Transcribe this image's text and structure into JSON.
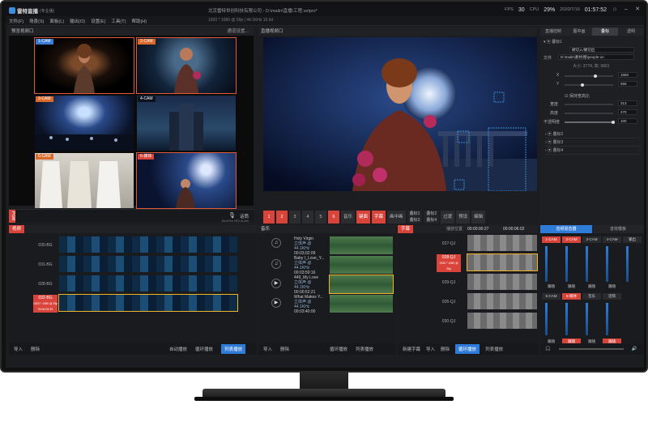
{
  "app": {
    "name": "雷特直播",
    "edition": "(专业版)",
    "company_title": "北京雷特世创科技有限公司",
    "project_path": "D:\\malin\\直播\\工程.velpro*",
    "resolution_info": "1920 * 1080 @ 50p  |  44.1KHz 16 bit",
    "fps_label": "FPS",
    "fps_value": "30",
    "cpu_label": "CPU",
    "cpu_value": "29%",
    "date": "2020/7/16",
    "time": "01:57:52"
  },
  "menu": [
    "文件(F)",
    "场景(S)",
    "面板(L)",
    "输出(O)",
    "设置(E)",
    "工具(T)",
    "帮助(H)"
  ],
  "multiview": {
    "title": "预览视频口",
    "switch_label": "通道设置...",
    "cams": [
      {
        "label": "1-CAM",
        "color": "blue"
      },
      {
        "label": "2-CAM",
        "color": "orange"
      },
      {
        "label": "3-CAM",
        "color": "orange"
      },
      {
        "label": "4-CAM",
        "color": "dark"
      },
      {
        "label": "5-CAM",
        "color": "orange"
      },
      {
        "label": "6-媒体",
        "color": "red"
      }
    ]
  },
  "pg_bar": {
    "tab": "PGM",
    "mic_label": "话筒",
    "ndi_label": "NewTek NDI Audio"
  },
  "program": {
    "title": "直播视频口",
    "buttons": [
      "1",
      "2",
      "3",
      "4",
      "5",
      "6"
    ],
    "extra_buttons": [
      "音乐",
      "键面",
      "字幕",
      "画中画"
    ],
    "group_buttons": [
      "叠标1",
      "叠标2",
      "叠标3",
      "叠标4"
    ],
    "right_buttons": [
      "过渡",
      "预设",
      "编辑"
    ]
  },
  "right_panel": {
    "tabs": [
      "直播控制",
      "图中画",
      "叠标",
      "透明"
    ],
    "active_tab": "叠标",
    "layer_header": "叠标1",
    "mode_value": "硬切入/硬切出",
    "file_label": "文件",
    "file_value": "D:\\malin\\素材\\图\\people-on",
    "size_info": "大小: 3774, 高: 5661",
    "x_label": "X",
    "x_value": "1550",
    "y_label": "Y",
    "y_value": "565",
    "keep_ratio": "保持宽高比",
    "width_label": "宽度",
    "width_value": "313",
    "height_label": "高度",
    "height_value": "470",
    "opacity_label": "不透明度",
    "opacity_value": "100",
    "layers": [
      "叠标2",
      "叠标3",
      "叠标4"
    ]
  },
  "video_panel": {
    "title": "视频",
    "clips": [
      {
        "name": "030-BG",
        "info": ""
      },
      {
        "name": "031-BG",
        "info": ""
      },
      {
        "name": "028-BG",
        "info": ""
      },
      {
        "name": "032-BG",
        "info": "1920 * 1080 @ 25p\n00:00:04:29"
      }
    ],
    "footer": [
      "导入",
      "删除",
      "自动播放",
      "循环播放",
      "列表播放"
    ],
    "active_footer": "列表播放"
  },
  "music_panel": {
    "title": "音乐",
    "songs": [
      {
        "title": "Holy Virgin",
        "sub": "立体声 @ 44.1KHz",
        "time": "00:03:02:09"
      },
      {
        "title": "Baby I_Love_Y...",
        "sub": "立体声 @ 44.1KHz",
        "time": "00:03:59:16"
      },
      {
        "title": "449_My Love",
        "sub": "立体声 @ 44.1KHz",
        "time": "00:00:52:21"
      },
      {
        "title": "What Makes Y...",
        "sub": "立体声 @ 44.1KHz",
        "time": "00:03:40:00"
      }
    ],
    "footer": [
      "导入",
      "删除",
      "循环播放",
      "列表播放"
    ]
  },
  "subtitle_panel": {
    "title": "字幕",
    "time_label": "播放位置",
    "time_value": "00:00:00:27",
    "total_label": "00:00:06:02",
    "clips": [
      "027-QJ",
      "028-QJ",
      "029-QJ",
      "026-QJ",
      "030-QJ"
    ],
    "selected_info": "1920 * 1080 @ 25p",
    "footer": [
      "新建字幕",
      "导入",
      "删除",
      "循环播放",
      "列表播放"
    ],
    "active_footer": "循环播放"
  },
  "mixer": {
    "tabs": [
      "音频混音器",
      "音效模板"
    ],
    "channels_top": [
      "1-CAM",
      "2-CAM",
      "3-CAM",
      "4-CAM",
      "输出"
    ],
    "channels_bottom": [
      "5-CAM",
      "6-媒体",
      "音乐",
      "话筒"
    ],
    "labels_mid": [
      "跟随",
      "跟随",
      "跟随",
      "跟随"
    ],
    "labels_bot": [
      "跟随",
      "跟随",
      "跟随",
      "跟随"
    ]
  }
}
